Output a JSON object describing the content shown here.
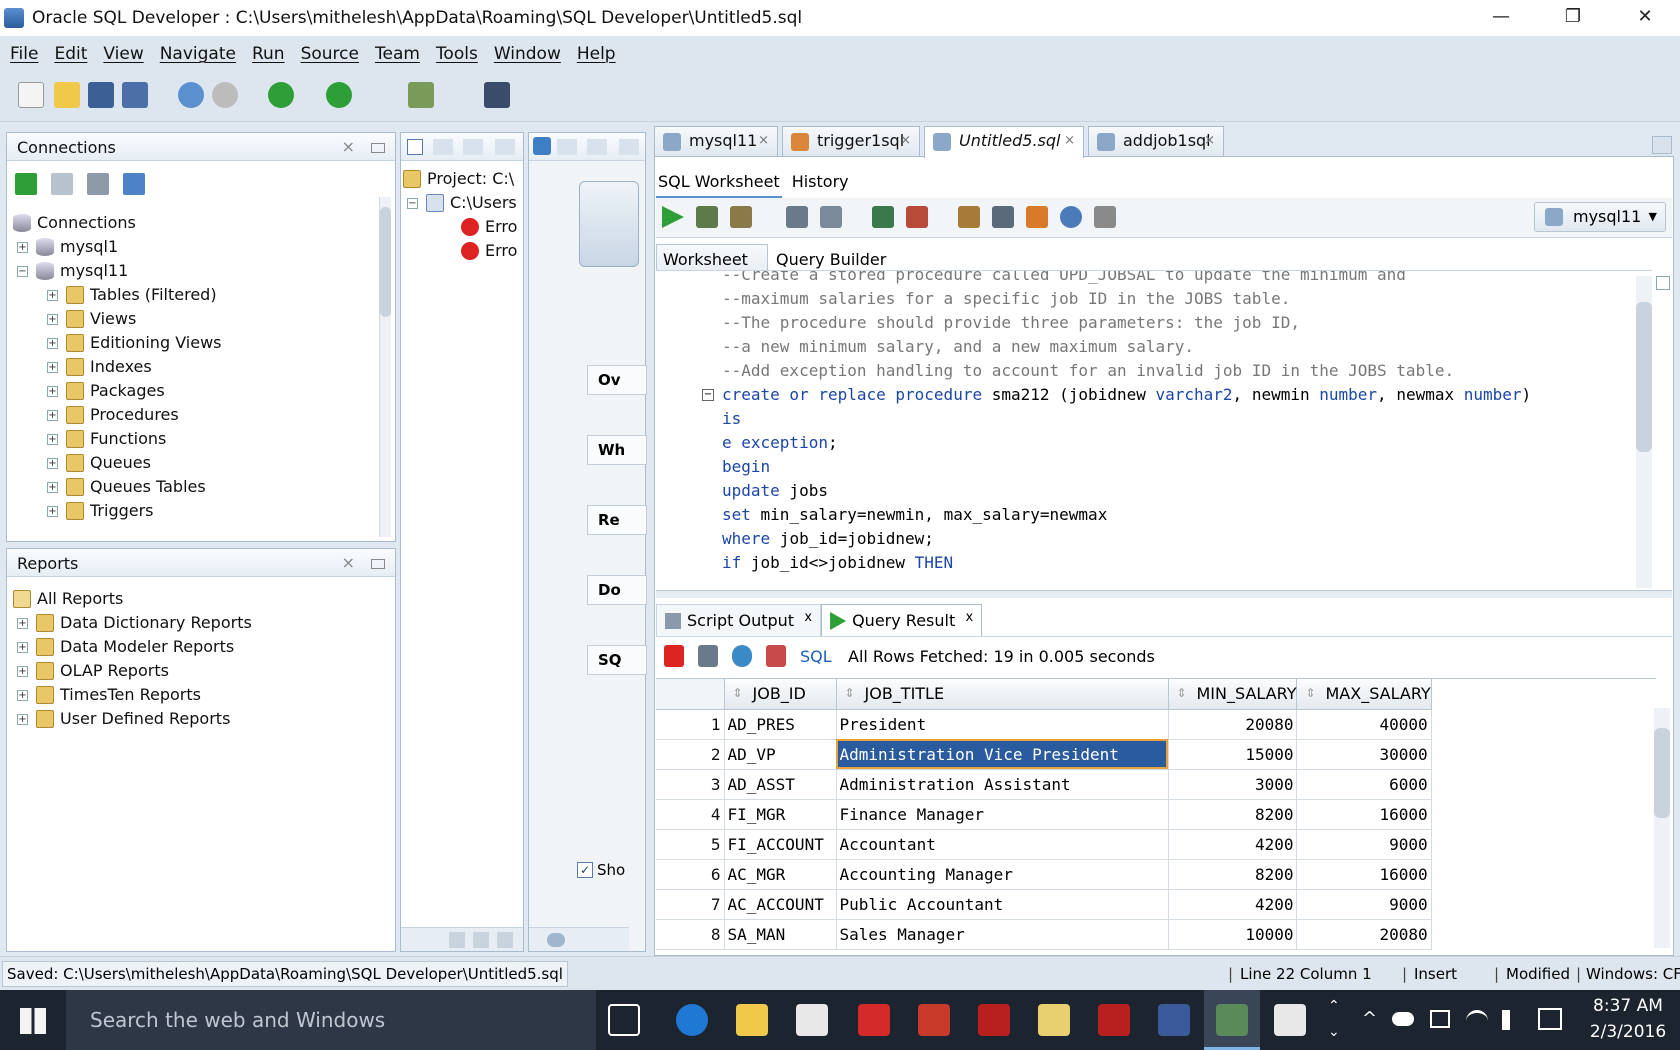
{
  "window": {
    "title": "Oracle SQL Developer : C:\\Users\\mithelesh\\AppData\\Roaming\\SQL Developer\\Untitled5.sql",
    "minimize": "—",
    "restore": "❐",
    "close": "✕"
  },
  "menu": [
    "File",
    "Edit",
    "View",
    "Navigate",
    "Run",
    "Source",
    "Team",
    "Tools",
    "Window",
    "Help"
  ],
  "connections_panel": {
    "title": "Connections",
    "close": "×",
    "root": "Connections",
    "items": [
      {
        "label": "mysql1",
        "expander": "+"
      },
      {
        "label": "mysql11",
        "expander": "−"
      },
      {
        "label": "Tables (Filtered)",
        "expander": "+"
      },
      {
        "label": "Views",
        "expander": "+"
      },
      {
        "label": "Editioning Views",
        "expander": "+"
      },
      {
        "label": "Indexes",
        "expander": "+"
      },
      {
        "label": "Packages",
        "expander": "+"
      },
      {
        "label": "Procedures",
        "expander": "+"
      },
      {
        "label": "Functions",
        "expander": "+"
      },
      {
        "label": "Queues",
        "expander": "+"
      },
      {
        "label": "Queues Tables",
        "expander": "+"
      },
      {
        "label": "Triggers",
        "expander": "+"
      }
    ]
  },
  "reports_panel": {
    "title": "Reports",
    "close": "×",
    "root": "All Reports",
    "items": [
      "Data Dictionary Reports",
      "Data Modeler Reports",
      "OLAP Reports",
      "TimesTen Reports",
      "User Defined Reports"
    ]
  },
  "project_panel": {
    "project": "Project: C:\\",
    "users": "C:\\Users",
    "errors": [
      "Erro",
      "Erro"
    ]
  },
  "start_panel": {
    "buttons": [
      "Ov",
      "Wh",
      "Re",
      "Do",
      "SQ"
    ],
    "show_label": "Sho"
  },
  "editor_tabs": [
    {
      "label": "mysql11",
      "active": false
    },
    {
      "label": "trigger1sql",
      "active": false
    },
    {
      "label": "Untitled5.sql",
      "active": true
    },
    {
      "label": "addjob1sql",
      "active": false
    }
  ],
  "tab_close": "×",
  "worksheet_tabs": [
    "SQL Worksheet",
    "History"
  ],
  "connection_selector": "mysql11",
  "sub_tabs": [
    "Worksheet",
    "Query Builder"
  ],
  "code_lines": [
    {
      "t": "--Create a stored procedure called UPD_JOBSAL to update the minimum and",
      "c": "cmt"
    },
    {
      "t": "--maximum salaries for a specific job ID in the JOBS table.",
      "c": "cmt"
    },
    {
      "t": "--The procedure should provide three parameters: the job ID,",
      "c": "cmt"
    },
    {
      "t": "--a new minimum salary, and a new maximum salary.",
      "c": "cmt"
    },
    {
      "t": "--Add exception handling to account for an invalid job ID in the JOBS table.",
      "c": "cmt"
    }
  ],
  "code_fold": "−",
  "code_misc": {
    "create_kw": "create or replace procedure",
    "create_rest1": " sma212 (jobidnew ",
    "varchar2": "varchar2",
    "create_rest2": ", newmin ",
    "number1": "number",
    "create_rest3": ", newmax ",
    "number2": "number",
    "create_rest4": ")",
    "is": "is",
    "exc_kw": "e exception",
    "exc_rest": ";",
    "begin": "begin",
    "update_kw": "update",
    "update_rest": " jobs",
    "set_kw": "set",
    "set_rest": " min_salary=newmin, max_salary=newmax",
    "where_kw": "where",
    "where_rest": " job_id=jobidnew;",
    "if_kw": "if",
    "if_rest": " job_id<>jobidnew ",
    "then_kw": "THEN"
  },
  "result_tabs": [
    {
      "label": "Script Output",
      "close": "x"
    },
    {
      "label": "Query Result",
      "close": "x"
    }
  ],
  "result_toolbar": {
    "sql_link": "SQL",
    "status": "All Rows Fetched: 19 in 0.005 seconds"
  },
  "results": {
    "columns": [
      "JOB_ID",
      "JOB_TITLE",
      "MIN_SALARY",
      "MAX_SALARY"
    ],
    "rows": [
      [
        "1",
        "AD_PRES",
        "President",
        "20080",
        "40000"
      ],
      [
        "2",
        "AD_VP",
        "Administration Vice President",
        "15000",
        "30000"
      ],
      [
        "3",
        "AD_ASST",
        "Administration Assistant",
        "3000",
        "6000"
      ],
      [
        "4",
        "FI_MGR",
        "Finance Manager",
        "8200",
        "16000"
      ],
      [
        "5",
        "FI_ACCOUNT",
        "Accountant",
        "4200",
        "9000"
      ],
      [
        "6",
        "AC_MGR",
        "Accounting Manager",
        "8200",
        "16000"
      ],
      [
        "7",
        "AC_ACCOUNT",
        "Public Accountant",
        "4200",
        "9000"
      ],
      [
        "8",
        "SA_MAN",
        "Sales Manager",
        "10000",
        "20080"
      ]
    ],
    "selected_cell": {
      "row": 1,
      "col": 2
    }
  },
  "statusbar": {
    "saved": "Saved: C:\\Users\\mithelesh\\AppData\\Roaming\\SQL Developer\\Untitled5.sql",
    "position": "Line 22 Column 1",
    "mode": "Insert",
    "modified": "Modified",
    "windows": "Windows: CF"
  },
  "taskbar": {
    "search_placeholder": "Search the web and Windows",
    "time": "8:37 AM",
    "date": "2/3/2016"
  }
}
